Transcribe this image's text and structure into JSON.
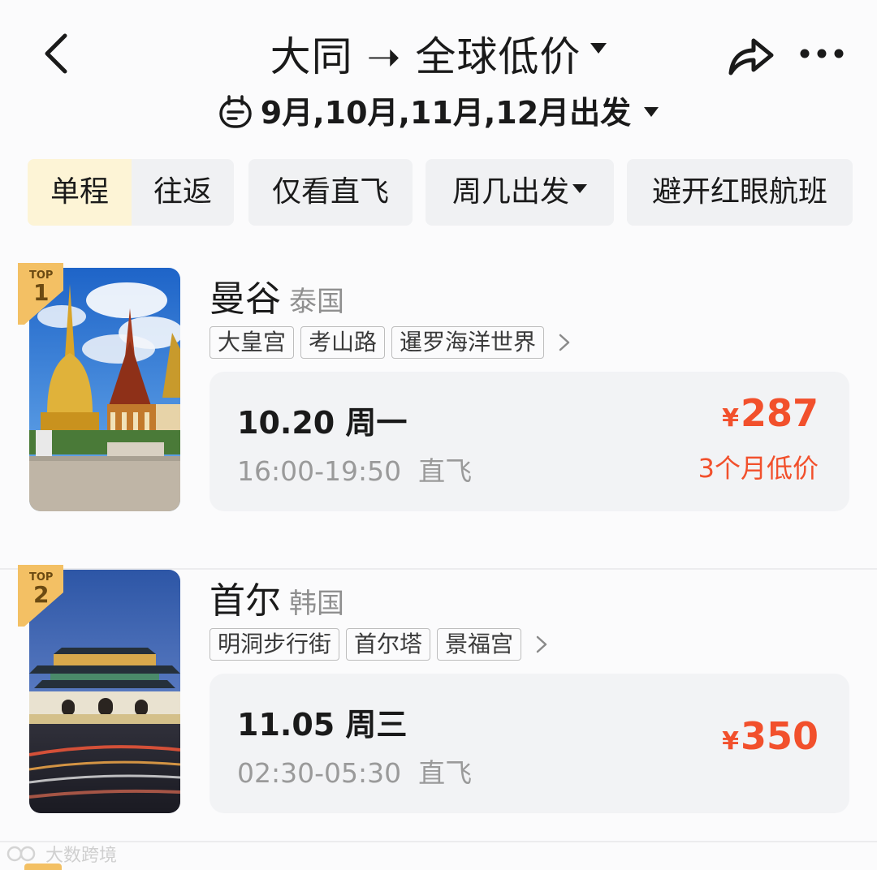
{
  "header": {
    "title": "大同 ➝ 全球低价",
    "subtitle": "9月,10月,11月,12月出发"
  },
  "filters": {
    "oneway": "单程",
    "roundtrip": "往返",
    "direct_only": "仅看直飞",
    "weekday": "周几出发",
    "avoid_redeye": "避开红眼航班"
  },
  "colors": {
    "price": "#f2502c",
    "active_segment": "#fdf4d6",
    "chip_bg": "#f0f1f3",
    "badge_gold": "#f3c064"
  },
  "destinations": [
    {
      "rank_label": "TOP",
      "rank": "1",
      "city": "曼谷",
      "country": "泰国",
      "tags": [
        "大皇宫",
        "考山路",
        "暹罗海洋世界"
      ],
      "date": "10.20 周一",
      "time": "16:00-19:50  直飞",
      "currency": "¥",
      "price": "287",
      "note": "3个月低价"
    },
    {
      "rank_label": "TOP",
      "rank": "2",
      "city": "首尔",
      "country": "韩国",
      "tags": [
        "明洞步行街",
        "首尔塔",
        "景福宫"
      ],
      "date": "11.05 周三",
      "time": "02:30-05:30  直飞",
      "currency": "¥",
      "price": "350",
      "note": ""
    }
  ],
  "watermark": "大数跨境"
}
